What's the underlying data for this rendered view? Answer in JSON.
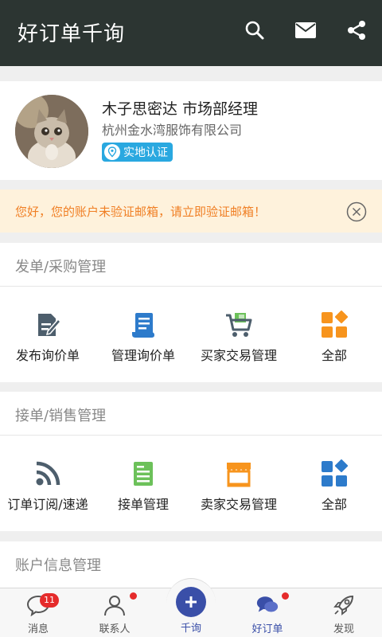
{
  "header": {
    "title": "好订单千询",
    "icons": [
      "search-icon",
      "mail-icon",
      "share-icon"
    ]
  },
  "profile": {
    "name": "木子思密达 市场部经理",
    "company": "杭州金水湾服饰有限公司",
    "badge": "实地认证"
  },
  "notice": {
    "text": "您好，您的账户未验证邮箱，请立即验证邮箱！"
  },
  "sections": [
    {
      "title": "发单/采购管理",
      "items": [
        {
          "label": "发布询价单",
          "icon": "edit-form-icon"
        },
        {
          "label": "管理询价单",
          "icon": "document-scroll-icon"
        },
        {
          "label": "买家交易管理",
          "icon": "cart-icon"
        },
        {
          "label": "全部",
          "icon": "grid-all-icon"
        }
      ]
    },
    {
      "title": "接单/销售管理",
      "items": [
        {
          "label": "订单订阅/速递",
          "icon": "rss-icon"
        },
        {
          "label": "接单管理",
          "icon": "clipboard-icon"
        },
        {
          "label": "卖家交易管理",
          "icon": "storefront-icon"
        },
        {
          "label": "全部",
          "icon": "grid-all-icon"
        }
      ]
    },
    {
      "title": "账户信息管理"
    }
  ],
  "tabbar": {
    "items": [
      {
        "label": "消息",
        "badge": "11"
      },
      {
        "label": "联系人"
      },
      {
        "label": "千询"
      },
      {
        "label": "好订单"
      },
      {
        "label": "发现"
      }
    ]
  },
  "colors": {
    "header_bg": "#2c3532",
    "accent_blue": "#29a8e0",
    "notice_text": "#f07f24",
    "tab_active": "#3a4fa8",
    "badge_red": "#e52b2b"
  }
}
